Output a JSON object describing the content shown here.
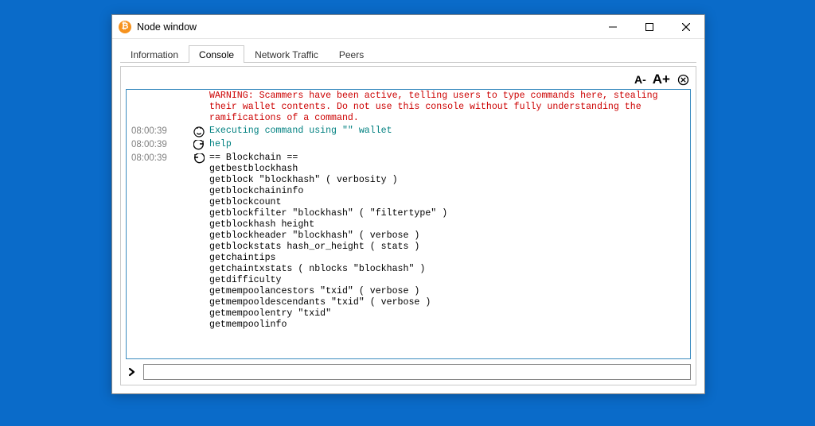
{
  "window": {
    "title": "Node window"
  },
  "tabs": [
    {
      "label": "Information",
      "active": false
    },
    {
      "label": "Console",
      "active": true
    },
    {
      "label": "Network Traffic",
      "active": false
    },
    {
      "label": "Peers",
      "active": false
    }
  ],
  "toolbar": {
    "decrease_label": "A-",
    "increase_label": "A+"
  },
  "console": {
    "warning": "WARNING: Scammers have been active, telling users to type commands here, stealing their wallet contents. Do not use this console without fully understanding the ramifications of a command.",
    "entries": [
      {
        "ts": "08:00:39",
        "kind": "info",
        "text": "Executing command using \"\" wallet"
      },
      {
        "ts": "08:00:39",
        "kind": "cmd",
        "text": "help"
      },
      {
        "ts": "08:00:39",
        "kind": "reply",
        "text": "== Blockchain ==\ngetbestblockhash\ngetblock \"blockhash\" ( verbosity )\ngetblockchaininfo\ngetblockcount\ngetblockfilter \"blockhash\" ( \"filtertype\" )\ngetblockhash height\ngetblockheader \"blockhash\" ( verbose )\ngetblockstats hash_or_height ( stats )\ngetchaintips\ngetchaintxstats ( nblocks \"blockhash\" )\ngetdifficulty\ngetmempoolancestors \"txid\" ( verbose )\ngetmempooldescendants \"txid\" ( verbose )\ngetmempoolentry \"txid\"\ngetmempoolinfo"
      }
    ],
    "input_value": ""
  }
}
